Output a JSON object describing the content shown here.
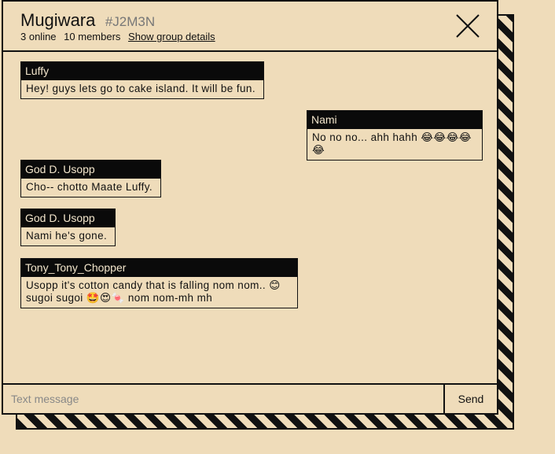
{
  "header": {
    "group_name": "Mugiwara",
    "group_code": "#J2M3N",
    "online": "3 online",
    "members": "10 members",
    "details_link": "Show group details"
  },
  "messages": [
    {
      "author": "Luffy",
      "text": "Hey! guys lets go to cake island. It will be fun."
    },
    {
      "author": "Nami",
      "text": "No no no... ahh hahh 😂😂😂😂😂"
    },
    {
      "author": "God D. Usopp",
      "text": "Cho-- chotto Maate Luffy."
    },
    {
      "author": "God D. Usopp",
      "text": "Nami he's gone."
    },
    {
      "author": "Tony_Tony_Chopper",
      "text": "Usopp it's cotton candy that is falling nom nom.. 😊 sugoi sugoi 🤩😍🍬 nom nom-mh mh"
    }
  ],
  "composer": {
    "placeholder": "Text message",
    "send_label": "Send"
  },
  "colors": {
    "background": "#efdcba",
    "ink": "#111111",
    "author_bar": "#0a0a0a"
  }
}
